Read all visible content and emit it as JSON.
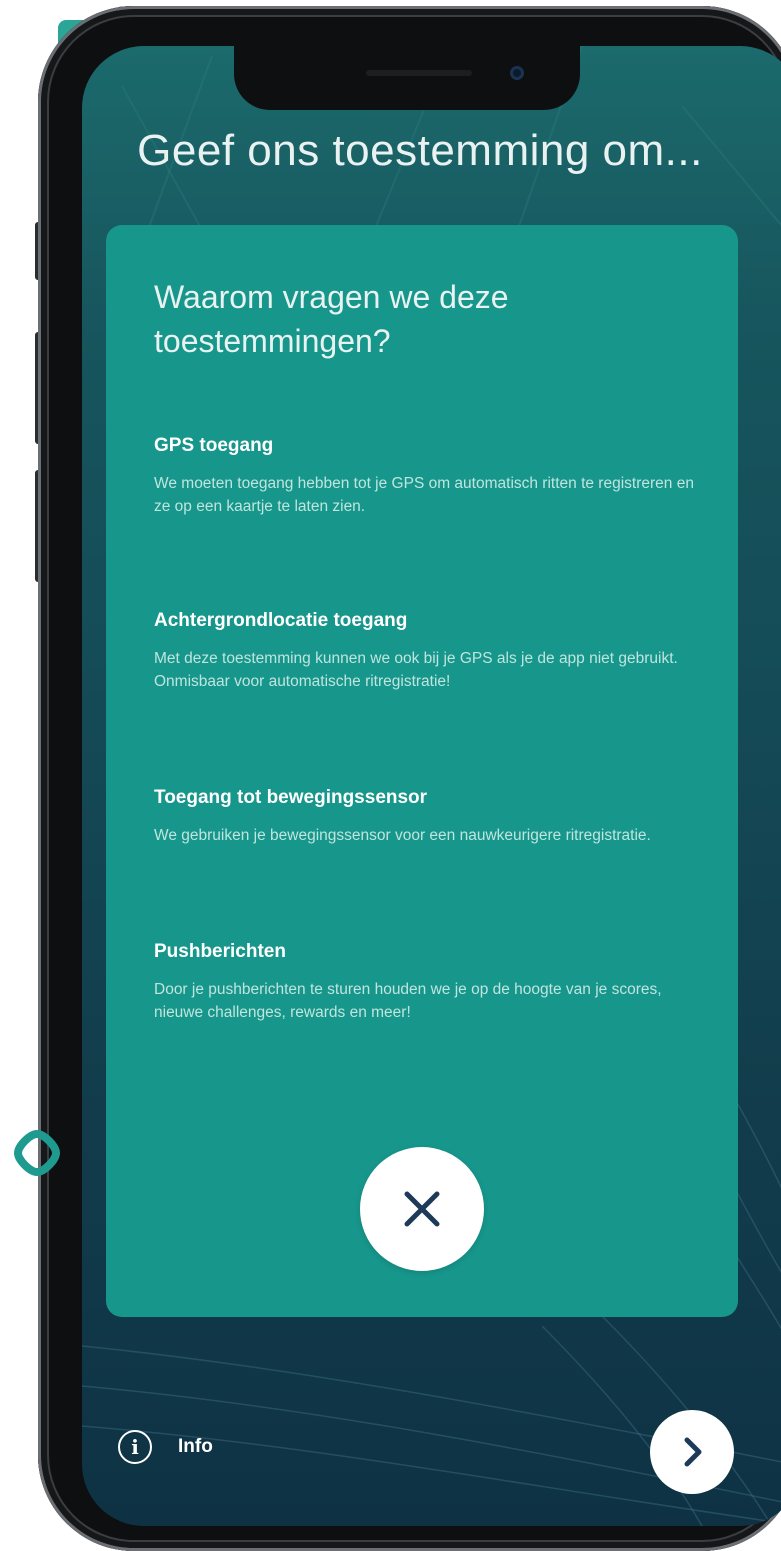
{
  "screen": {
    "title": "Geef ons toestemming om..."
  },
  "card": {
    "heading": "Waarom vragen we deze toestemmingen?",
    "sections": [
      {
        "title": "GPS toegang",
        "text": "We moeten toegang hebben tot je GPS om automatisch ritten te registreren en ze op een kaartje te laten zien."
      },
      {
        "title": "Achtergrondlocatie toegang",
        "text": "Met deze toestemming kunnen we ook bij je GPS als je de app niet gebruikt. Onmisbaar voor automatische ritregistratie!"
      },
      {
        "title": "Toegang tot bewegingssensor",
        "text": "We gebruiken je bewegingssensor voor een nauwkeurigere ritregistratie."
      },
      {
        "title": "Pushberichten",
        "text": "Door je pushberichten te sturen houden we je op de hoogte van je scores, nieuwe challenges, rewards en meer!"
      }
    ],
    "close_icon": "close-icon"
  },
  "footer": {
    "info_label": "Info",
    "info_icon": "info-icon",
    "next_icon": "chevron-right-icon"
  },
  "colors": {
    "card": "#17968b",
    "background": "#144a56",
    "icon_dark": "#1d3a58",
    "accent": "#2aa596"
  }
}
